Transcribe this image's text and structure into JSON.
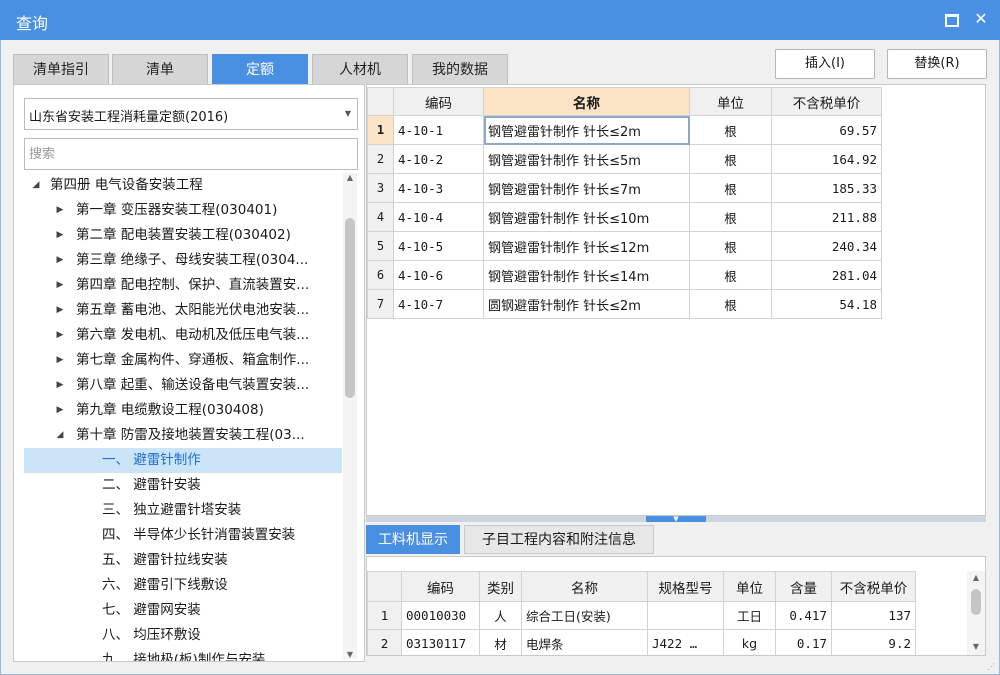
{
  "window": {
    "title": "查询"
  },
  "tabs": [
    "清单指引",
    "清单",
    "定额",
    "人材机",
    "我的数据"
  ],
  "toolbar": {
    "insert_label": "插入(I)",
    "replace_label": "替换(R)"
  },
  "library": {
    "selected": "山东省安装工程消耗量定额(2016)"
  },
  "search": {
    "placeholder": "搜索"
  },
  "tree": {
    "root": "第四册 电气设备安装工程",
    "chapters": [
      "第一章 变压器安装工程(030401)",
      "第二章 配电装置安装工程(030402)",
      "第三章 绝缘子、母线安装工程(0304...",
      "第四章 配电控制、保护、直流装置安...",
      "第五章 蓄电池、太阳能光伏电池安装...",
      "第六章 发电机、电动机及低压电气装...",
      "第七章 金属构件、穿通板、箱盒制作...",
      "第八章 起重、输送设备电气装置安装...",
      "第九章 电缆敷设工程(030408)",
      "第十章 防雷及接地装置安装工程(03..."
    ],
    "sections": [
      "一、 避雷针制作",
      "二、 避雷针安装",
      "三、 独立避雷针塔安装",
      "四、 半导体少长针消雷装置安装",
      "五、 避雷针拉线安装",
      "六、 避雷引下线敷设",
      "七、 避雷网安装",
      "八、 均压环敷设",
      "九、 接地极(板)制作与安装"
    ]
  },
  "quota_table": {
    "headers": [
      "编码",
      "名称",
      "单位",
      "不含税单价"
    ],
    "rows": [
      {
        "no": "1",
        "code": "4-10-1",
        "name": "钢管避雷针制作 针长≤2m",
        "unit": "根",
        "price": "69.57"
      },
      {
        "no": "2",
        "code": "4-10-2",
        "name": "钢管避雷针制作 针长≤5m",
        "unit": "根",
        "price": "164.92"
      },
      {
        "no": "3",
        "code": "4-10-3",
        "name": "钢管避雷针制作 针长≤7m",
        "unit": "根",
        "price": "185.33"
      },
      {
        "no": "4",
        "code": "4-10-4",
        "name": "钢管避雷针制作 针长≤10m",
        "unit": "根",
        "price": "211.88"
      },
      {
        "no": "5",
        "code": "4-10-5",
        "name": "钢管避雷针制作 针长≤12m",
        "unit": "根",
        "price": "240.34"
      },
      {
        "no": "6",
        "code": "4-10-6",
        "name": "钢管避雷针制作 针长≤14m",
        "unit": "根",
        "price": "281.04"
      },
      {
        "no": "7",
        "code": "4-10-7",
        "name": "圆钢避雷针制作 针长≤2m",
        "unit": "根",
        "price": "54.18"
      }
    ]
  },
  "bottom_tabs": [
    "工料机显示",
    "子目工程内容和附注信息"
  ],
  "resource_table": {
    "headers": [
      "编码",
      "类别",
      "名称",
      "规格型号",
      "单位",
      "含量",
      "不含税单价"
    ],
    "rows": [
      {
        "no": "1",
        "code": "00010030",
        "type": "人",
        "name": "综合工日(安装)",
        "spec": "",
        "unit": "工日",
        "qty": "0.417",
        "price": "137"
      },
      {
        "no": "2",
        "code": "03130117",
        "type": "材",
        "name": "电焊条",
        "spec": "J422 …",
        "unit": "kg",
        "qty": "0.17",
        "price": "9.2"
      }
    ]
  },
  "colors": {
    "accent": "#4a90e2",
    "selection": "#cce4f7",
    "header_highlight": "#fbe3c6"
  },
  "icons": [
    "maximize-icon",
    "close-icon",
    "dropdown-arrow-icon",
    "tree-collapse-icon",
    "tree-expand-icon",
    "scroll-up-icon",
    "scroll-down-icon",
    "resize-grip-icon"
  ]
}
